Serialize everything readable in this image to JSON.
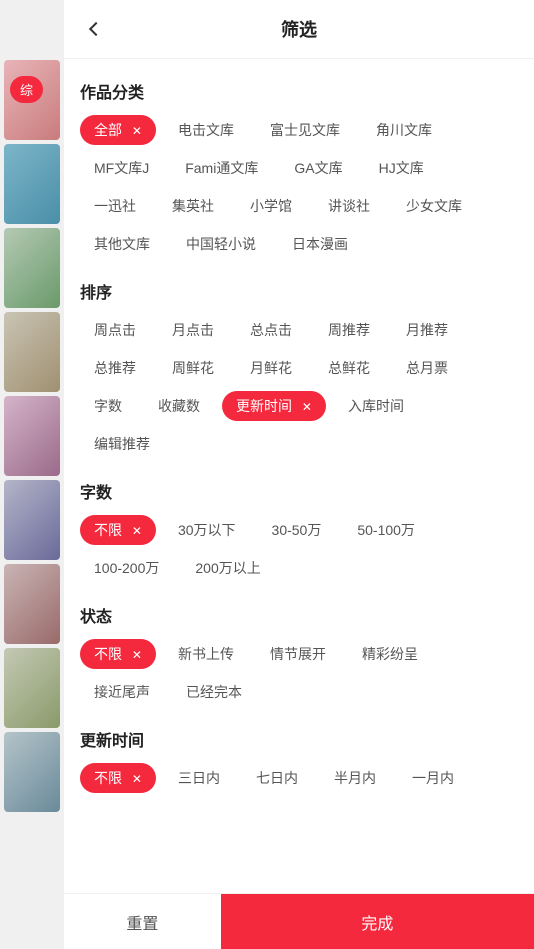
{
  "header": {
    "title": "筛选",
    "back_label": "back"
  },
  "sections": {
    "category": {
      "label": "作品分类",
      "tags": [
        {
          "id": "all",
          "text": "全部",
          "active": true
        },
        {
          "id": "dianjiwenku",
          "text": "电击文库",
          "active": false
        },
        {
          "id": "fujimiwenku",
          "text": "富士见文库",
          "active": false
        },
        {
          "id": "jiaochwenku",
          "text": "角川文库",
          "active": false
        },
        {
          "id": "mfwenkuj",
          "text": "MF文库J",
          "active": false
        },
        {
          "id": "famiwenku",
          "text": "Fami通文库",
          "active": false
        },
        {
          "id": "gawenku",
          "text": "GA文库",
          "active": false
        },
        {
          "id": "hjwenku",
          "text": "HJ文库",
          "active": false
        },
        {
          "id": "yizhenshe",
          "text": "一迅社",
          "active": false
        },
        {
          "id": "jiyingshe",
          "text": "集英社",
          "active": false
        },
        {
          "id": "xiaoxueguan",
          "text": "小学馆",
          "active": false
        },
        {
          "id": "jiangtianshe",
          "text": "讲谈社",
          "active": false
        },
        {
          "id": "shaonuwenku",
          "text": "少女文库",
          "active": false
        },
        {
          "id": "qitawenku",
          "text": "其他文库",
          "active": false
        },
        {
          "id": "zhongguoqingxiaoshuo",
          "text": "中国轻小说",
          "active": false
        },
        {
          "id": "ribenmanhua",
          "text": "日本漫画",
          "active": false
        }
      ]
    },
    "sort": {
      "label": "排序",
      "tags": [
        {
          "id": "zhoudianjie",
          "text": "周点击",
          "active": false
        },
        {
          "id": "yuedianjie",
          "text": "月点击",
          "active": false
        },
        {
          "id": "zongdianjie",
          "text": "总点击",
          "active": false
        },
        {
          "id": "zhoutijian",
          "text": "周推荐",
          "active": false
        },
        {
          "id": "yuetijian",
          "text": "月推荐",
          "active": false
        },
        {
          "id": "zongtijian",
          "text": "总推荐",
          "active": false
        },
        {
          "id": "zhouxianhua",
          "text": "周鲜花",
          "active": false
        },
        {
          "id": "yuexianhua",
          "text": "月鲜花",
          "active": false
        },
        {
          "id": "zongxianhua",
          "text": "总鲜花",
          "active": false
        },
        {
          "id": "zongyuepiao",
          "text": "总月票",
          "active": false
        },
        {
          "id": "zishu",
          "text": "字数",
          "active": false
        },
        {
          "id": "shoucangshuo",
          "text": "收藏数",
          "active": false
        },
        {
          "id": "genxinshijian",
          "text": "更新时间",
          "active": true
        },
        {
          "id": "rukushijian",
          "text": "入库时间",
          "active": false
        },
        {
          "id": "bianjituijian",
          "text": "编辑推荐",
          "active": false
        }
      ]
    },
    "wordcount": {
      "label": "字数",
      "tags": [
        {
          "id": "buxian",
          "text": "不限",
          "active": true
        },
        {
          "id": "30wan",
          "text": "30万以下",
          "active": false
        },
        {
          "id": "30-50wan",
          "text": "30-50万",
          "active": false
        },
        {
          "id": "50-100wan",
          "text": "50-100万",
          "active": false
        },
        {
          "id": "100-200wan",
          "text": "100-200万",
          "active": false
        },
        {
          "id": "200wan",
          "text": "200万以上",
          "active": false
        }
      ]
    },
    "status": {
      "label": "状态",
      "tags": [
        {
          "id": "buxian",
          "text": "不限",
          "active": true
        },
        {
          "id": "xinshushangchuan",
          "text": "新书上传",
          "active": false
        },
        {
          "id": "qingjianzhankai",
          "text": "情节展开",
          "active": false
        },
        {
          "id": "jingcaifenchen",
          "text": "精彩纷呈",
          "active": false
        },
        {
          "id": "jiejinyisheng",
          "text": "接近尾声",
          "active": false
        },
        {
          "id": "yijingwanben",
          "text": "已经完本",
          "active": false
        }
      ]
    },
    "update_time": {
      "label": "更新时间",
      "tags": [
        {
          "id": "buxian",
          "text": "不限",
          "active": true
        },
        {
          "id": "sanrinei",
          "text": "三日内",
          "active": false
        },
        {
          "id": "qirinei",
          "text": "七日内",
          "active": false
        },
        {
          "id": "banyuenei",
          "text": "半月内",
          "active": false
        },
        {
          "id": "yiyuenei",
          "text": "一月内",
          "active": false
        }
      ]
    }
  },
  "footer": {
    "reset_label": "重置",
    "confirm_label": "完成"
  },
  "left_indicator": "综"
}
